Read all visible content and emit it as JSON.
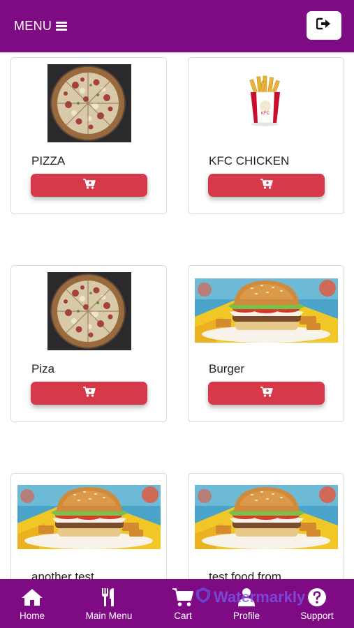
{
  "header": {
    "menu_label": "MENU",
    "menu_icon": "hamburger-icon",
    "logout_icon": "logout-icon"
  },
  "colors": {
    "brand": "#7e0b84",
    "cart_button": "#d63a4a"
  },
  "products": [
    {
      "name": "PIZZA",
      "image": "pizza-image",
      "button_icon": "cart-icon"
    },
    {
      "name": "KFC CHICKEN",
      "image": "kfc-fries-image",
      "button_icon": "cart-icon"
    },
    {
      "name": "Piza",
      "image": "pizza-image",
      "button_icon": "cart-icon"
    },
    {
      "name": "Burger",
      "image": "burger-image",
      "button_icon": "cart-icon"
    },
    {
      "name": "another test",
      "image": "burger-image",
      "button_icon": "cart-icon"
    },
    {
      "name": "test food from",
      "image": "burger-image",
      "button_icon": "cart-icon"
    }
  ],
  "bottom_nav": {
    "items": [
      {
        "label": "Home",
        "icon": "home-icon"
      },
      {
        "label": "Main Menu",
        "icon": "utensils-icon"
      },
      {
        "label": "Cart",
        "icon": "cart-icon"
      },
      {
        "label": "Profile",
        "icon": "user-icon"
      },
      {
        "label": "Support",
        "icon": "help-icon"
      }
    ]
  },
  "watermark": {
    "text": "Watermarkly"
  }
}
